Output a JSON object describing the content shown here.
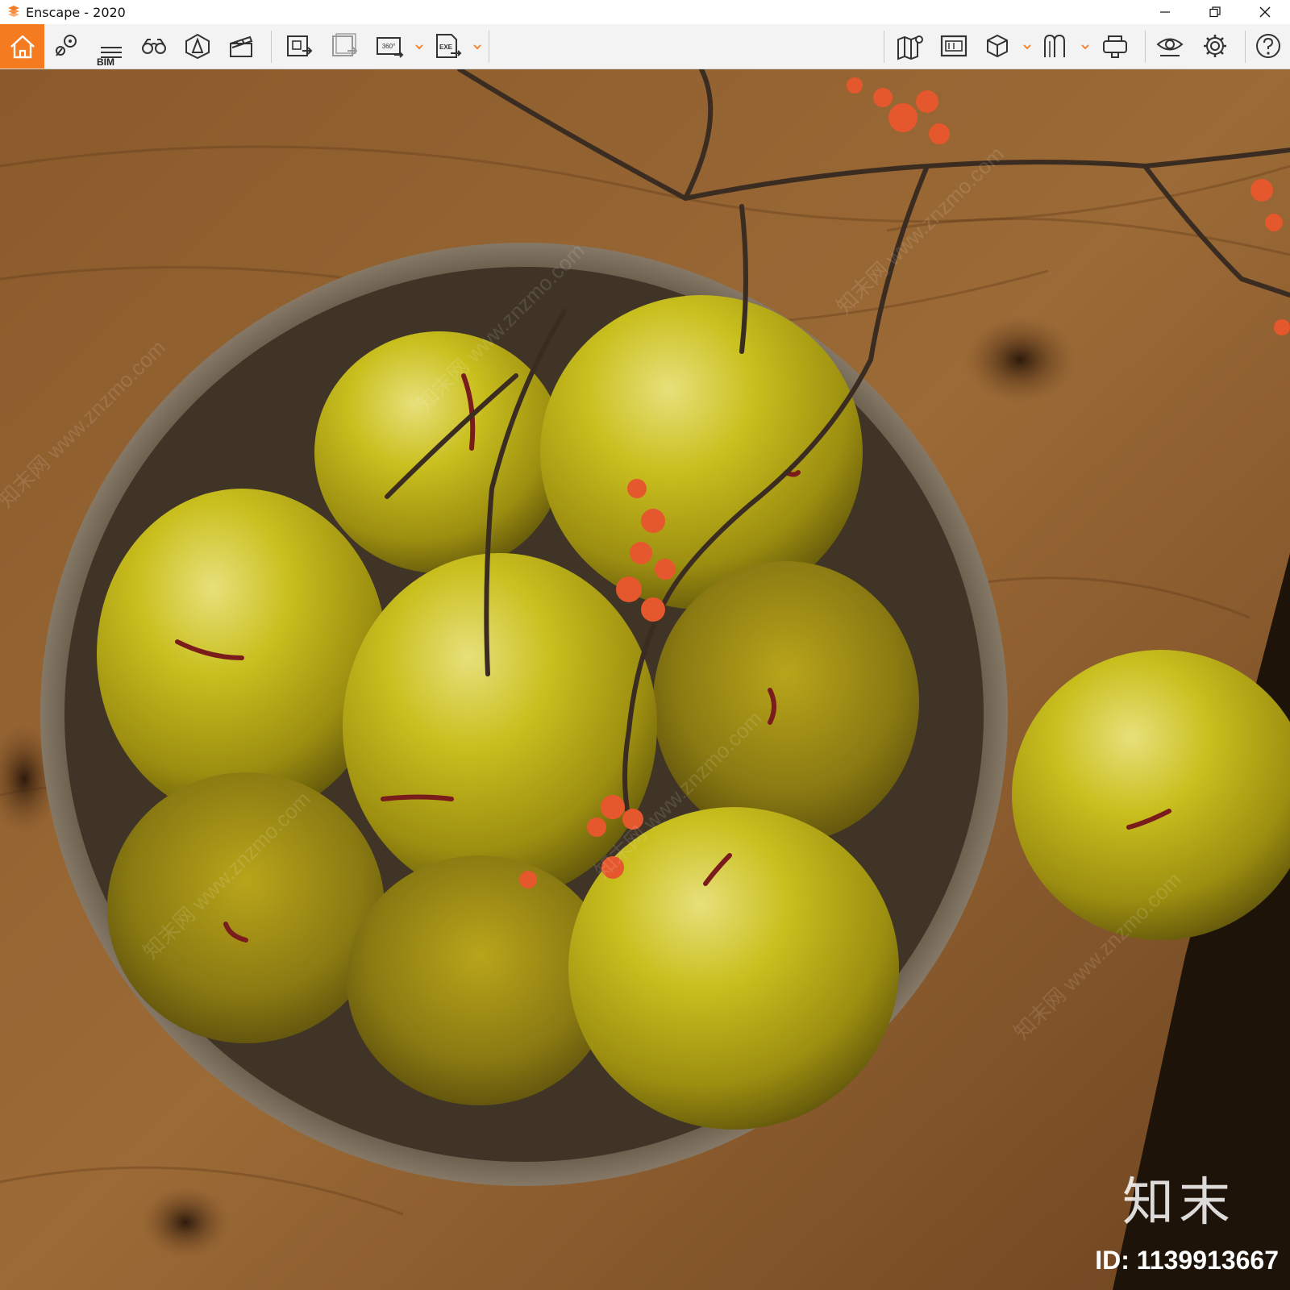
{
  "window": {
    "title": "Enscape - 2020",
    "accent_color": "#f47b20"
  },
  "toolbar": {
    "bim_label": "BIM",
    "buttons": [
      {
        "name": "home-icon"
      },
      {
        "name": "view-management-icon"
      },
      {
        "name": "bim-info-icon"
      },
      {
        "name": "binoculars-icon"
      },
      {
        "name": "asset-library-icon"
      },
      {
        "name": "video-editor-icon"
      },
      {
        "name": "screenshot-export-icon"
      },
      {
        "name": "batch-render-icon"
      },
      {
        "name": "panorama-360-icon"
      },
      {
        "name": "exe-standalone-icon"
      },
      {
        "name": "map-icon"
      },
      {
        "name": "upload-icon"
      },
      {
        "name": "cube-icon"
      },
      {
        "name": "materials-icon"
      },
      {
        "name": "vr-headset-icon"
      },
      {
        "name": "visual-settings-icon"
      },
      {
        "name": "settings-gear-icon"
      },
      {
        "name": "help-icon"
      }
    ]
  },
  "viewport": {
    "watermark_logo": "知末",
    "watermark_id": "ID: 1139913667",
    "watermark_pattern": "知末网 www.znzmo.com",
    "scene": "bowl of yellow-green apples on wooden table with blossom branch"
  }
}
